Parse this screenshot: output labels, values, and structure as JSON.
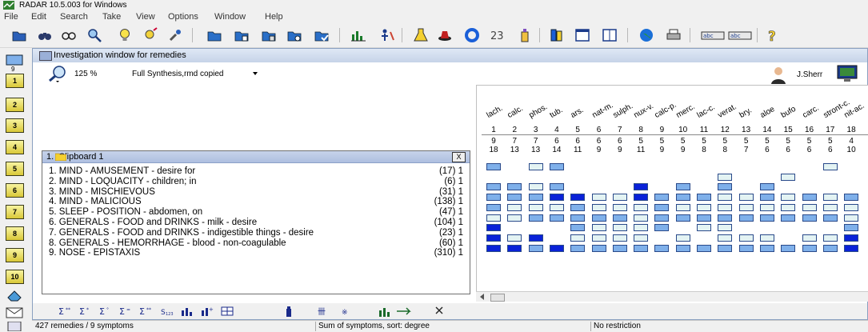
{
  "app": {
    "title": "RADAR 10.5.003 for Windows"
  },
  "menu": [
    "File",
    "Edit",
    "Search",
    "Take",
    "View",
    "Options",
    "Window",
    "Help"
  ],
  "nav_buttons": [
    "1",
    "2",
    "3",
    "4",
    "5",
    "6",
    "7",
    "8",
    "9",
    "10"
  ],
  "nav_top_marker": "9",
  "investigation": {
    "title": "Investigation window for remedies",
    "zoom": "125 %",
    "repertory": "Full Synthesis,rmd copied",
    "user": "J.Sherr"
  },
  "clipboard": {
    "header": "1.  Clipboard 1",
    "close": "X",
    "rubrics": [
      {
        "text": "1. MIND - AMUSEMENT - desire for",
        "count": "(17) 1"
      },
      {
        "text": "2. MIND - LOQUACITY - children; in",
        "count": "(6) 1"
      },
      {
        "text": "3. MIND - MISCHIEVOUS",
        "count": "(31) 1"
      },
      {
        "text": "4. MIND - MALICIOUS",
        "count": "(138) 1"
      },
      {
        "text": "5. SLEEP - POSITION - abdomen, on",
        "count": "(47) 1"
      },
      {
        "text": "6. GENERALS - FOOD and DRINKS - milk - desire",
        "count": "(104) 1"
      },
      {
        "text": "7. GENERALS - FOOD and DRINKS - indigestible things - desire",
        "count": "(23) 1"
      },
      {
        "text": "8. GENERALS - HEMORRHAGE - blood - non-coagulable",
        "count": "(60) 1"
      },
      {
        "text": "9. NOSE - EPISTAXIS",
        "count": "(310) 1"
      }
    ]
  },
  "grid": {
    "remedies": [
      {
        "abbr": "lach.",
        "idx": "1",
        "hits": "9",
        "score": "18"
      },
      {
        "abbr": "calc.",
        "idx": "2",
        "hits": "7",
        "score": "13"
      },
      {
        "abbr": "phos.",
        "idx": "3",
        "hits": "7",
        "score": "13"
      },
      {
        "abbr": "tub.",
        "idx": "4",
        "hits": "6",
        "score": "14"
      },
      {
        "abbr": "ars.",
        "idx": "5",
        "hits": "6",
        "score": "11"
      },
      {
        "abbr": "nat-m.",
        "idx": "6",
        "hits": "6",
        "score": "9"
      },
      {
        "abbr": "sulph.",
        "idx": "7",
        "hits": "6",
        "score": "9"
      },
      {
        "abbr": "nux-v.",
        "idx": "8",
        "hits": "5",
        "score": "11"
      },
      {
        "abbr": "calc-p.",
        "idx": "9",
        "hits": "5",
        "score": "9"
      },
      {
        "abbr": "merc.",
        "idx": "10",
        "hits": "5",
        "score": "9"
      },
      {
        "abbr": "lac-c.",
        "idx": "11",
        "hits": "5",
        "score": "8"
      },
      {
        "abbr": "verat.",
        "idx": "12",
        "hits": "5",
        "score": "8"
      },
      {
        "abbr": "bry.",
        "idx": "13",
        "hits": "5",
        "score": "7"
      },
      {
        "abbr": "aloe",
        "idx": "14",
        "hits": "5",
        "score": "6"
      },
      {
        "abbr": "bufo",
        "idx": "15",
        "hits": "5",
        "score": "6"
      },
      {
        "abbr": "carc.",
        "idx": "16",
        "hits": "5",
        "score": "6"
      },
      {
        "abbr": "stront-c.",
        "idx": "17",
        "hits": "5",
        "score": "6"
      },
      {
        "abbr": "nit-ac.",
        "idx": "18",
        "hits": "4",
        "score": "10"
      }
    ],
    "cells": [
      [
        2,
        0,
        1,
        2,
        0,
        0,
        0,
        0,
        0,
        0,
        0,
        0,
        0,
        0,
        0,
        0,
        1,
        0
      ],
      [
        0,
        0,
        0,
        0,
        0,
        0,
        0,
        0,
        0,
        0,
        0,
        1,
        0,
        0,
        1,
        0,
        0,
        0
      ],
      [
        2,
        2,
        1,
        2,
        0,
        0,
        0,
        3,
        0,
        2,
        0,
        2,
        0,
        2,
        0,
        0,
        0,
        0
      ],
      [
        2,
        2,
        2,
        3,
        3,
        1,
        1,
        3,
        2,
        2,
        2,
        1,
        1,
        2,
        1,
        2,
        1,
        2
      ],
      [
        2,
        1,
        1,
        1,
        2,
        1,
        1,
        1,
        2,
        1,
        1,
        1,
        1,
        1,
        1,
        1,
        1,
        1
      ],
      [
        1,
        1,
        2,
        2,
        2,
        2,
        2,
        1,
        2,
        2,
        2,
        2,
        2,
        2,
        2,
        2,
        2,
        1
      ],
      [
        3,
        0,
        0,
        0,
        2,
        1,
        1,
        1,
        2,
        0,
        1,
        1,
        0,
        0,
        0,
        0,
        0,
        2
      ],
      [
        3,
        1,
        3,
        0,
        1,
        1,
        1,
        1,
        0,
        1,
        0,
        1,
        1,
        1,
        0,
        1,
        1,
        3
      ],
      [
        3,
        3,
        2,
        3,
        2,
        2,
        2,
        2,
        2,
        2,
        2,
        2,
        2,
        2,
        2,
        2,
        2,
        3
      ]
    ],
    "colors": {
      "grade1": "#e3f3f3",
      "grade2": "#7fb0ea",
      "grade3": "#0a22d8"
    }
  },
  "status": {
    "left": "427 remedies / 9 symptoms",
    "middle": "Sum of symptoms, sort: degree",
    "right": "No restriction"
  }
}
